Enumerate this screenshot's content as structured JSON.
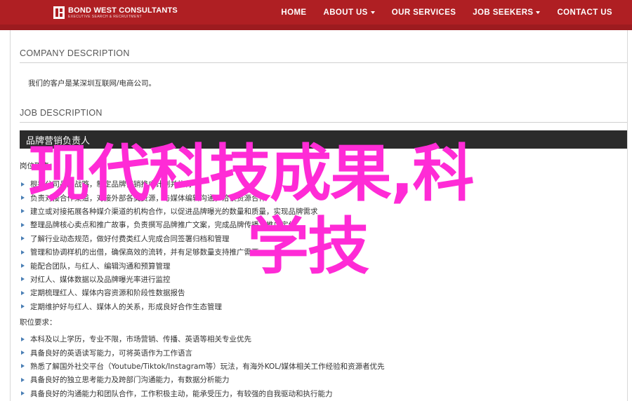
{
  "header": {
    "logo_title": "BOND WEST CONSULTANTS",
    "logo_subtitle": "EXECUTIVE SEARCH & RECRUITMENT",
    "nav": [
      {
        "label": "HOME",
        "has_dropdown": false
      },
      {
        "label": "ABOUT US",
        "has_dropdown": true
      },
      {
        "label": "OUR SERVICES",
        "has_dropdown": false
      },
      {
        "label": "JOB SEEKERS",
        "has_dropdown": true
      },
      {
        "label": "CONTACT US",
        "has_dropdown": false
      }
    ],
    "accent_color": "#af1f23"
  },
  "company": {
    "heading": "COMPANY DESCRIPTION",
    "text": "我们的客户是某深圳互联网/电商公司。"
  },
  "job": {
    "heading": "JOB DESCRIPTION",
    "title": "品牌营销负责人",
    "duties_label": "岗位职责：",
    "duties": [
      "根据公司品牌战略，制定品牌营销推广计划并执行",
      "负责对接合作渠道，对接外部各类资源，与媒体编辑沟通，洽谈资源合作",
      "建立或对接拓展各种媒介渠道的机构合作，以促进品牌曝光的数量和质量，实现品牌需求",
      "整理品牌核心卖点和推广故事，负责撰写品牌推广文案，完成品牌传播与推广定位",
      "了解行业动态规范，做好付费类红人完成合同签署归档和管理",
      "管理和协调样机的出借，确保高效的流转，并有足够数量支持推广需要",
      "能配合团队，与红人、编辑沟通和预算管理",
      "对红人、媒体数据以及品牌曝光率进行监控",
      "定期梳理红人、媒体内容资源和阶段性数据报告",
      "定期维护好与红人、媒体人的关系，形成良好合作生态管理"
    ],
    "requirements_label": "职位要求：",
    "requirements": [
      "本科及以上学历，专业不限，市场营销、传播、英语等相关专业优先",
      "具备良好的英语读写能力，可将英语作为工作语言",
      "熟悉了解国外社交平台（Youtube/Tiktok/Instagram等）玩法，有海外KOL/媒体相关工作经验和资源者优先",
      "具备良好的独立思考能力及跨部门沟通能力，有数据分析能力",
      "具备良好的沟通能力和团队合作，工作积极主动，能承受压力，有较强的自我驱动和执行能力"
    ]
  },
  "overlay": {
    "line1": "现代科技成果,科",
    "line2": "学技",
    "color": "#ff2bd6"
  }
}
